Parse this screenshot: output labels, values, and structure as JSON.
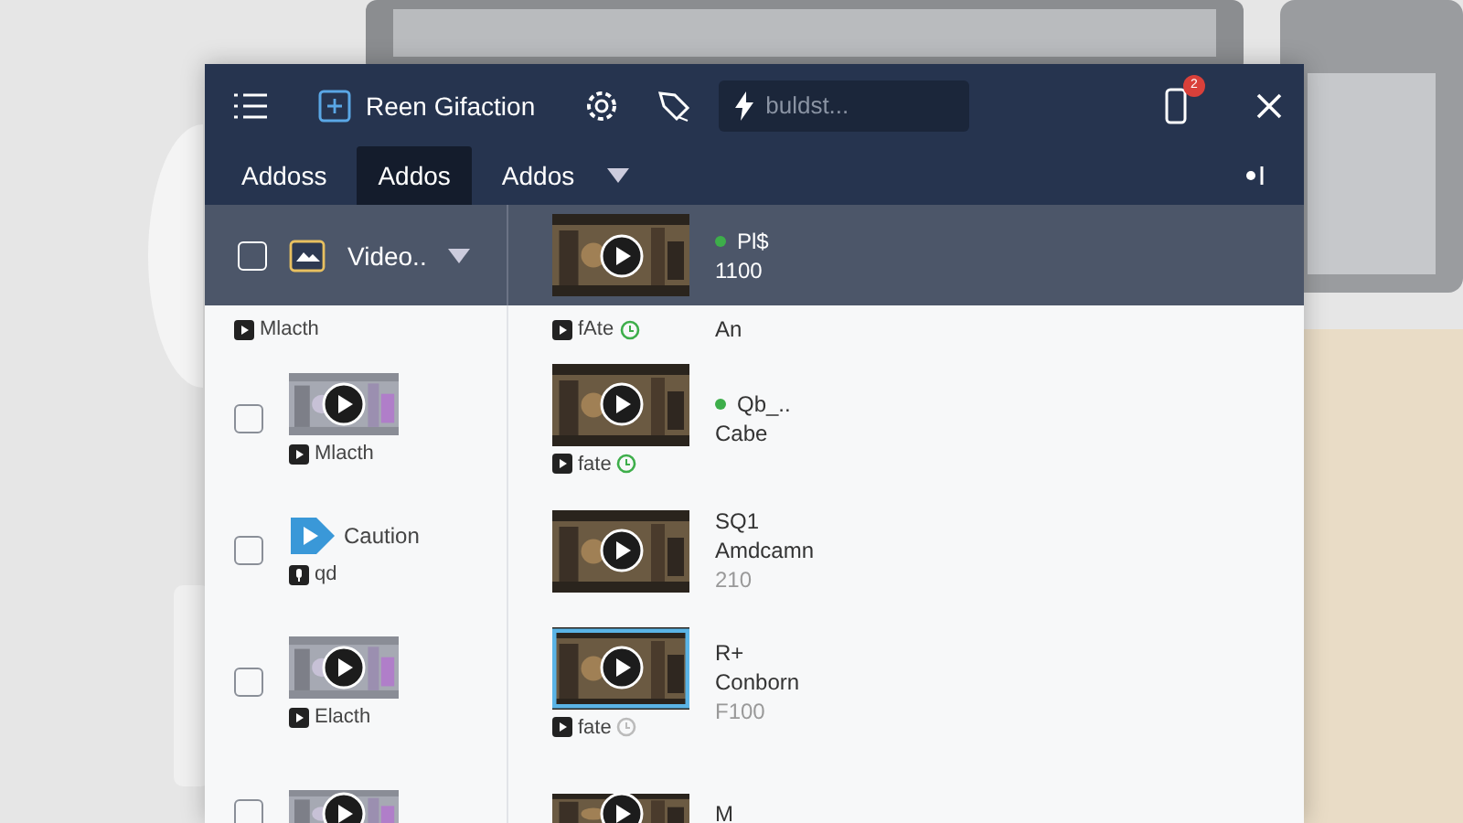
{
  "window": {
    "title": "Reen Gifaction",
    "search": {
      "placeholder": "buldst..."
    },
    "notification_count": "2"
  },
  "tabs": [
    {
      "label": "Addoss",
      "selected": false
    },
    {
      "label": "Addos",
      "selected": true
    },
    {
      "label": "Addos",
      "selected": false
    }
  ],
  "pinned_bar": {
    "checked": false,
    "label": "Video..",
    "right": {
      "status_dot": true,
      "lines": [
        "Pl$",
        "1100"
      ]
    }
  },
  "rows": [
    {
      "left": {
        "kind": "none",
        "label": "Mlacth"
      },
      "right": {
        "kind": "continued",
        "status_dot": false,
        "lines": [
          "An"
        ],
        "badge": {
          "label": "fAte",
          "done": true
        }
      }
    },
    {
      "left": {
        "kind": "video",
        "checked": false,
        "label": "Mlacth"
      },
      "right": {
        "kind": "video",
        "selected": false,
        "status_dot": true,
        "lines": [
          "Qb_..",
          "Cabe"
        ],
        "badge": {
          "label": "fate",
          "done": true
        }
      }
    },
    {
      "left": {
        "kind": "logo",
        "checked": false,
        "caption": "Caution",
        "label": "qd"
      },
      "right": {
        "kind": "video",
        "selected": false,
        "status_dot": false,
        "lines": [
          "SQ1",
          "Amdcamn",
          "210"
        ]
      }
    },
    {
      "left": {
        "kind": "video",
        "checked": false,
        "label": "Elacth"
      },
      "right": {
        "kind": "video",
        "selected": true,
        "status_dot": false,
        "lines": [
          "R+",
          "Conborn",
          "F100"
        ],
        "badge": {
          "label": "fate",
          "done": false
        }
      }
    },
    {
      "left": {
        "kind": "video",
        "checked": false
      },
      "right": {
        "kind": "video",
        "selected": false,
        "status_dot": false,
        "lines": [
          "M"
        ]
      }
    }
  ]
}
